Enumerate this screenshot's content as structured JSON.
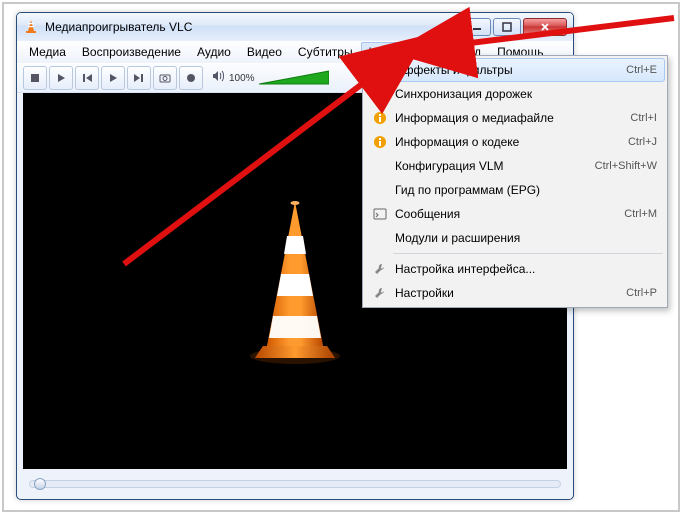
{
  "window": {
    "title": "Медиапроигрыватель VLC"
  },
  "menu": {
    "items": [
      {
        "label": "Медиа"
      },
      {
        "label": "Воспроизведение"
      },
      {
        "label": "Аудио"
      },
      {
        "label": "Видео"
      },
      {
        "label": "Субтитры"
      },
      {
        "label": "Инструменты"
      },
      {
        "label": "Вид"
      },
      {
        "label": "Помощь"
      }
    ],
    "active_index": 5
  },
  "toolbar": {
    "volume_text": "100%"
  },
  "dropdown": {
    "groups": [
      {
        "items": [
          {
            "icon": "equalizer",
            "label": "Эффекты и фильтры",
            "shortcut": "Ctrl+E",
            "hover": true
          },
          {
            "icon": "sync",
            "label": "Синхронизация дорожек",
            "shortcut": ""
          },
          {
            "icon": "info",
            "label": "Информация о медиафайле",
            "shortcut": "Ctrl+I"
          },
          {
            "icon": "info",
            "label": "Информация о кодеке",
            "shortcut": "Ctrl+J"
          },
          {
            "icon": "",
            "label": "Конфигурация VLM",
            "shortcut": "Ctrl+Shift+W"
          },
          {
            "icon": "",
            "label": "Гид по программам (EPG)",
            "shortcut": ""
          },
          {
            "icon": "msg",
            "label": "Сообщения",
            "shortcut": "Ctrl+M"
          },
          {
            "icon": "",
            "label": "Модули и расширения",
            "shortcut": ""
          }
        ]
      },
      {
        "items": [
          {
            "icon": "wrench",
            "label": "Настройка интерфейса...",
            "shortcut": ""
          },
          {
            "icon": "wrench",
            "label": "Настройки",
            "shortcut": "Ctrl+P"
          }
        ]
      }
    ]
  }
}
